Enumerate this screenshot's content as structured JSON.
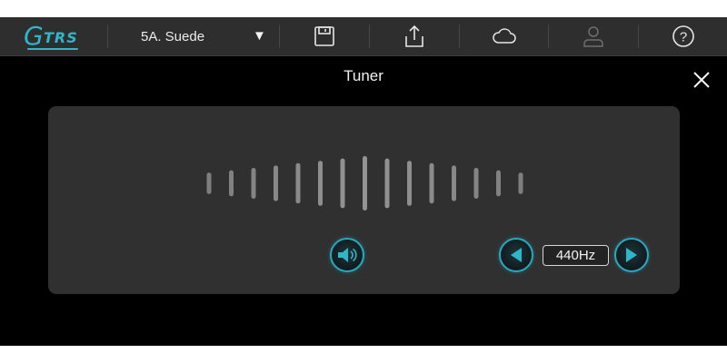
{
  "toolbar": {
    "logo_letter": "G",
    "logo_text": "TRS",
    "preset_name": "5A. Suede",
    "preset_arrow": "▼",
    "icons": [
      "save-icon",
      "upload-icon",
      "cloud-icon",
      "user-icon",
      "help-icon"
    ]
  },
  "tuner": {
    "title": "Tuner",
    "reference_frequency": "440Hz",
    "needle_count": 15,
    "center_index": 7
  },
  "colors": {
    "accent": "#2aa8bd",
    "toolbar_bg": "#2e2e2e",
    "panel_bg": "#3e3e3e",
    "needle": "#9a9a9a"
  }
}
